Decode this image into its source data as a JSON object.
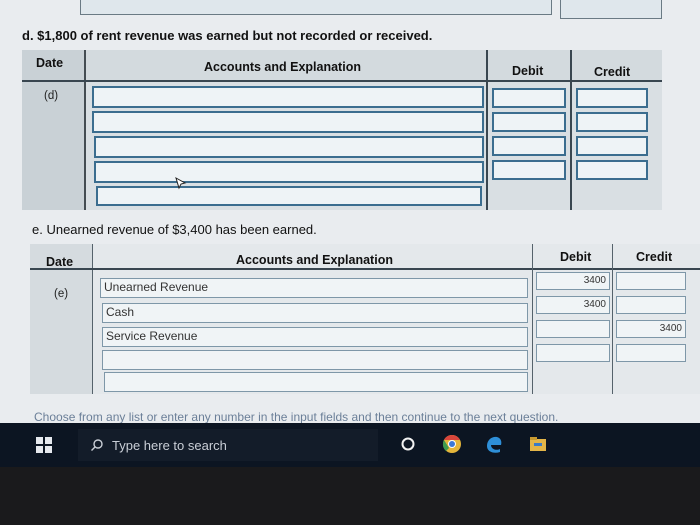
{
  "part_d": {
    "heading": "d. $1,800 of rent revenue was earned but not recorded or received.",
    "col_date": "Date",
    "col_accounts": "Accounts and Explanation",
    "col_debit": "Debit",
    "col_credit": "Credit",
    "date_label": "(d)",
    "rows": [
      {
        "account": "",
        "debit": "",
        "credit": ""
      },
      {
        "account": "",
        "debit": "",
        "credit": ""
      },
      {
        "account": "",
        "debit": "",
        "credit": ""
      },
      {
        "account": "",
        "debit": "",
        "credit": ""
      },
      {
        "account": "",
        "debit": "",
        "credit": ""
      }
    ]
  },
  "part_e": {
    "heading": "e. Unearned revenue of $3,400 has been earned.",
    "col_date": "Date",
    "col_accounts": "Accounts and Explanation",
    "col_debit": "Debit",
    "col_credit": "Credit",
    "date_label": "(e)",
    "rows": [
      {
        "account": "Unearned Revenue",
        "debit": "3400",
        "credit": ""
      },
      {
        "account": "Cash",
        "debit": "3400",
        "credit": ""
      },
      {
        "account": "Service Revenue",
        "debit": "",
        "credit": "3400"
      },
      {
        "account": "",
        "debit": "",
        "credit": ""
      },
      {
        "account": "",
        "debit": "",
        "credit": ""
      }
    ]
  },
  "instruction": "Choose from any list or enter any number in the input fields and then continue to the next question.",
  "taskbar": {
    "search_placeholder": "Type here to search",
    "icons": [
      "windows-start-icon",
      "search-icon",
      "cortana-circle-icon",
      "chrome-icon",
      "edge-icon",
      "file-explorer-icon"
    ]
  },
  "colors": {
    "field_border": "#3b6d8f",
    "taskbar": "#0c1522",
    "page_background": "#e9ecef"
  }
}
